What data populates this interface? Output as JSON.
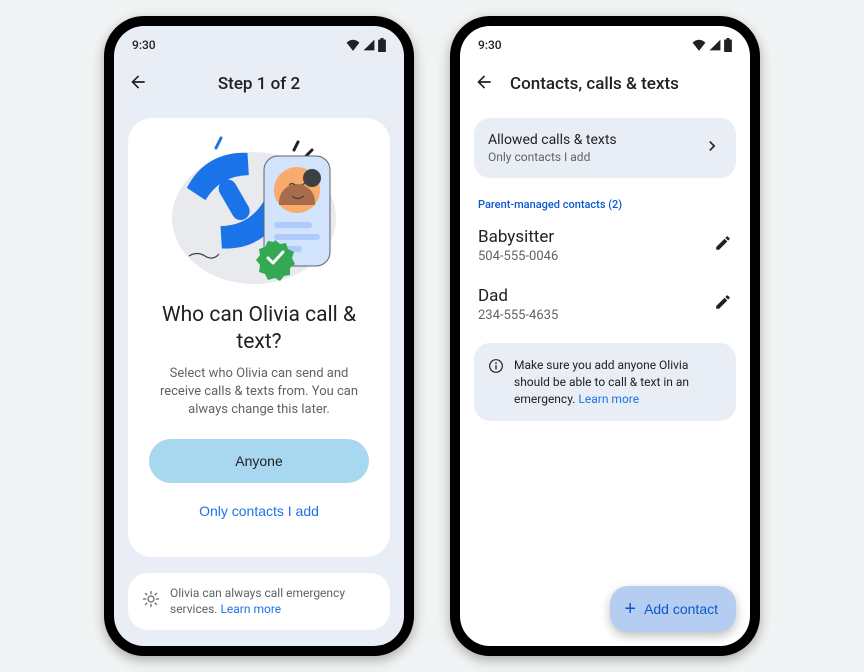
{
  "status": {
    "time": "9:30"
  },
  "phone1": {
    "step": "Step 1 of 2",
    "heading": "Who can Olivia call & text?",
    "subtext": "Select who Olivia can send and receive calls & texts from. You can always change this later.",
    "primaryBtn": "Anyone",
    "secondaryBtn": "Only contacts I add",
    "noticeText": "Olivia can always call emergency services. ",
    "noticeLink": "Learn more"
  },
  "phone2": {
    "title": "Contacts, calls & texts",
    "allowedTitle": "Allowed calls & texts",
    "allowedValue": "Only contacts I add",
    "sectionLabel": "Parent-managed contacts (2)",
    "contacts": [
      {
        "name": "Babysitter",
        "phone": "504-555-0046"
      },
      {
        "name": "Dad",
        "phone": "234-555-4635"
      }
    ],
    "infoText": "Make sure you add anyone Olivia should be able to call & text in an emergency. ",
    "infoLink": "Learn more",
    "fab": "Add contact"
  }
}
